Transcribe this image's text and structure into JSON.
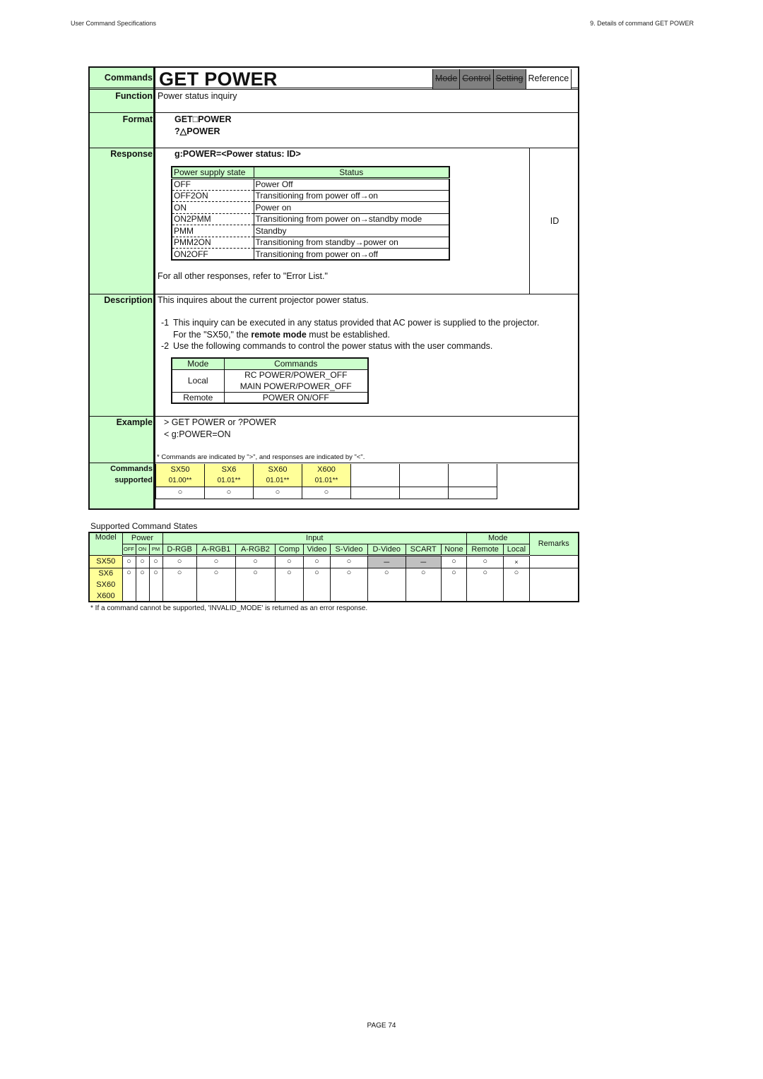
{
  "page_header": {
    "left": "User Command Specifications",
    "right": "9. Details of command  GET POWER"
  },
  "command": {
    "labels": {
      "commands": "Commands",
      "function": "Function",
      "format": "Format",
      "response": "Response",
      "description": "Description",
      "example": "Example",
      "supported_1": "Commands",
      "supported_2": "supported"
    },
    "title": "GET POWER",
    "tags": [
      {
        "label": "Mode",
        "active": false
      },
      {
        "label": "Control",
        "active": false
      },
      {
        "label": "Setting",
        "active": false
      },
      {
        "label": "Reference",
        "active": true
      }
    ],
    "function": "Power status inquiry",
    "format": [
      "GET□POWER",
      "?△POWER"
    ],
    "response": {
      "syntax": "g:POWER=<Power status: ID>",
      "table_headers": [
        "Power supply state",
        "Status"
      ],
      "rows": [
        {
          "state": "OFF",
          "status": "Power Off"
        },
        {
          "state": "OFF2ON",
          "status": "Transitioning from power off→on"
        },
        {
          "state": "ON",
          "status": "Power on"
        },
        {
          "state": "ON2PMM",
          "status": "Transitioning from power on→standby mode"
        },
        {
          "state": "PMM",
          "status": "Standby"
        },
        {
          "state": "PMM2ON",
          "status": "Transitioning from standby→power on"
        },
        {
          "state": "ON2OFF",
          "status": "Transitioning from power on→off"
        }
      ],
      "id_label": "ID",
      "other_note": "For all other responses, refer to \"Error List.\""
    },
    "description": {
      "summary": "This inquires about the current projector power status.",
      "note1_num": "-1",
      "note1_line1": "This inquiry can be executed in any status provided that AC power is supplied to the projector.",
      "note1_line2_pre": "For the \"SX50,\" the ",
      "note1_line2_bold": "remote mode",
      "note1_line2_post": " must be established.",
      "note2_num": "-2",
      "note2": "Use the following commands to control the power status with the user commands.",
      "mode_table": {
        "headers": [
          "Mode",
          "Commands"
        ],
        "rows": [
          {
            "mode": "Local",
            "commands": [
              "RC POWER/POWER_OFF",
              "MAIN POWER/POWER_OFF"
            ]
          },
          {
            "mode": "Remote",
            "commands": [
              "POWER ON/OFF"
            ]
          }
        ]
      }
    },
    "example": {
      "lines": [
        "> GET POWER or ?POWER",
        "< g:POWER=ON"
      ],
      "note": "* Commands are indicated by \">\", and responses are indicated by \"<\"."
    },
    "supported": {
      "models": [
        {
          "name": "SX50",
          "version": "01.00**",
          "mark": "○"
        },
        {
          "name": "SX6",
          "version": "01.01**",
          "mark": "○"
        },
        {
          "name": "SX60",
          "version": "01.01**",
          "mark": "○"
        },
        {
          "name": "X600",
          "version": "01.01**",
          "mark": "○"
        }
      ]
    }
  },
  "states": {
    "title": "Supported Command States",
    "headers": {
      "model": "Model",
      "power": "Power",
      "input": "Input",
      "mode": "Mode",
      "remarks": "Remarks",
      "power_cols": [
        "OFF",
        "ON",
        "PM"
      ],
      "input_cols": [
        "D-RGB",
        "A-RGB1",
        "A-RGB2",
        "Comp",
        "Video",
        "S-Video",
        "D-Video",
        "SCART",
        "None"
      ],
      "mode_cols": [
        "Remote",
        "Local"
      ]
    },
    "rows": [
      {
        "models": [
          "SX50"
        ],
        "power": [
          "○",
          "○",
          "○"
        ],
        "input": [
          "○",
          "○",
          "○",
          "○",
          "○",
          "○",
          "－",
          "－",
          "○"
        ],
        "mode": [
          "○",
          "×"
        ],
        "remarks": ""
      },
      {
        "models": [
          "SX6",
          "SX60",
          "X600"
        ],
        "power": [
          "○",
          "○",
          "○"
        ],
        "input": [
          "○",
          "○",
          "○",
          "○",
          "○",
          "○",
          "○",
          "○",
          "○"
        ],
        "mode": [
          "○",
          "○"
        ],
        "remarks": ""
      }
    ],
    "note": "* If a command cannot be supported, 'INVALID_MODE' is returned as an error response."
  },
  "footer": {
    "page": "PAGE 74"
  }
}
